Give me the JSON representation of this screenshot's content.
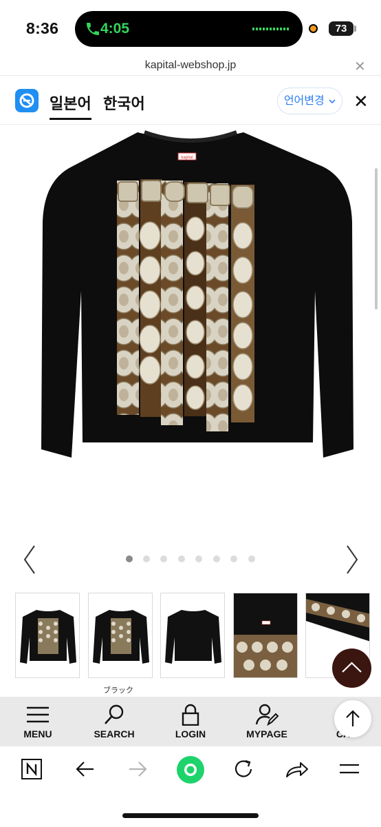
{
  "status_bar": {
    "time": "8:36",
    "call_time": "4:05",
    "battery": "73",
    "icons": [
      "phone-icon",
      "waveform-icon",
      "recording-dot-icon",
      "battery-icon"
    ],
    "colors": {
      "call": "#35d45b",
      "recording": "#f39a1d"
    }
  },
  "url_bar": {
    "domain": "kapital-webshop.jp",
    "close_icon": "close-icon"
  },
  "translate_bar": {
    "tabs": [
      {
        "label": "일본어",
        "active": true
      },
      {
        "label": "한국어",
        "active": false
      }
    ],
    "change_language_label": "언어변경",
    "icons": [
      "translate-logo-icon",
      "chevron-down-icon",
      "close-icon"
    ],
    "accent_color": "#2f7ff0"
  },
  "product": {
    "tag_text": "kapital",
    "image_subject": "black long-sleeve t-shirt",
    "carousel": {
      "slide_count": 8,
      "active_index": 0
    },
    "thumbnails": [
      {
        "caption": ""
      },
      {
        "caption": "ブラック"
      },
      {
        "caption": ""
      },
      {
        "caption": ""
      },
      {
        "caption": ""
      }
    ]
  },
  "site_nav": {
    "items": [
      {
        "label": "MENU",
        "icon": "hamburger-menu-icon"
      },
      {
        "label": "SEARCH",
        "icon": "search-icon"
      },
      {
        "label": "LOGIN",
        "icon": "lock-icon"
      },
      {
        "label": "MYPAGE",
        "icon": "user-edit-icon"
      },
      {
        "label": "CA",
        "icon": "cart-icon"
      }
    ]
  },
  "browser_toolbar": {
    "buttons": [
      "naver-icon",
      "back-icon",
      "forward-icon",
      "home-green-icon",
      "reload-icon",
      "share-icon",
      "more-menu-icon"
    ],
    "accent_color": "#1ed36b"
  }
}
